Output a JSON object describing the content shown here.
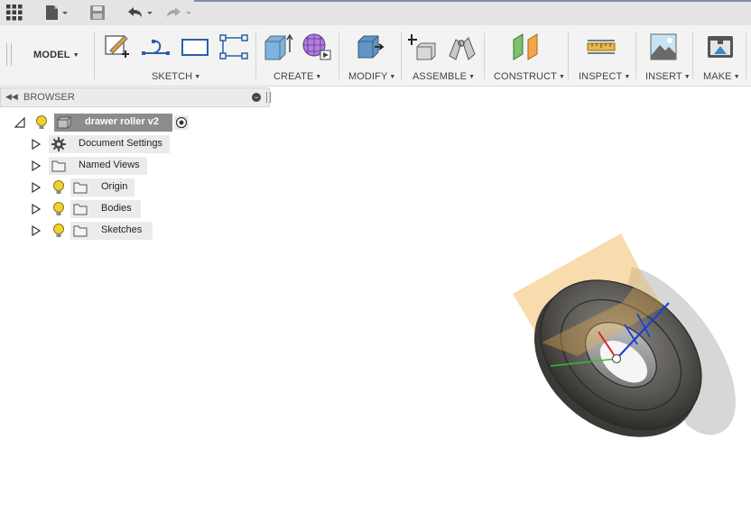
{
  "model_workspace": {
    "label": "MODEL"
  },
  "toolbar_groups": {
    "sketch": "SKETCH",
    "create": "CREATE",
    "modify": "MODIFY",
    "assemble": "ASSEMBLE",
    "construct": "CONSTRUCT",
    "inspect": "INSPECT",
    "insert": "INSERT",
    "make": "MAKE"
  },
  "browser": {
    "title": "BROWSER",
    "root": "drawer roller v2",
    "items": [
      {
        "label": "Document Settings",
        "icon": "gear-icon"
      },
      {
        "label": "Named Views",
        "icon": "folder-icon"
      },
      {
        "label": "Origin",
        "icon": "folder-icon",
        "visible": true
      },
      {
        "label": "Bodies",
        "icon": "folder-icon",
        "visible": true
      },
      {
        "label": "Sketches",
        "icon": "folder-icon",
        "visible": true
      }
    ]
  },
  "colors": {
    "toolbar_bg": "#f3f3f3",
    "title_bar_bg": "#e4e4e4",
    "root_node_bg": "#8c8c8c",
    "bulb_on": "#f2d02f",
    "construction_plane": "#f0b14a",
    "axis_blue": "#1f3fd6",
    "axis_red": "#d12a1f",
    "axis_green": "#2fbf2f"
  }
}
